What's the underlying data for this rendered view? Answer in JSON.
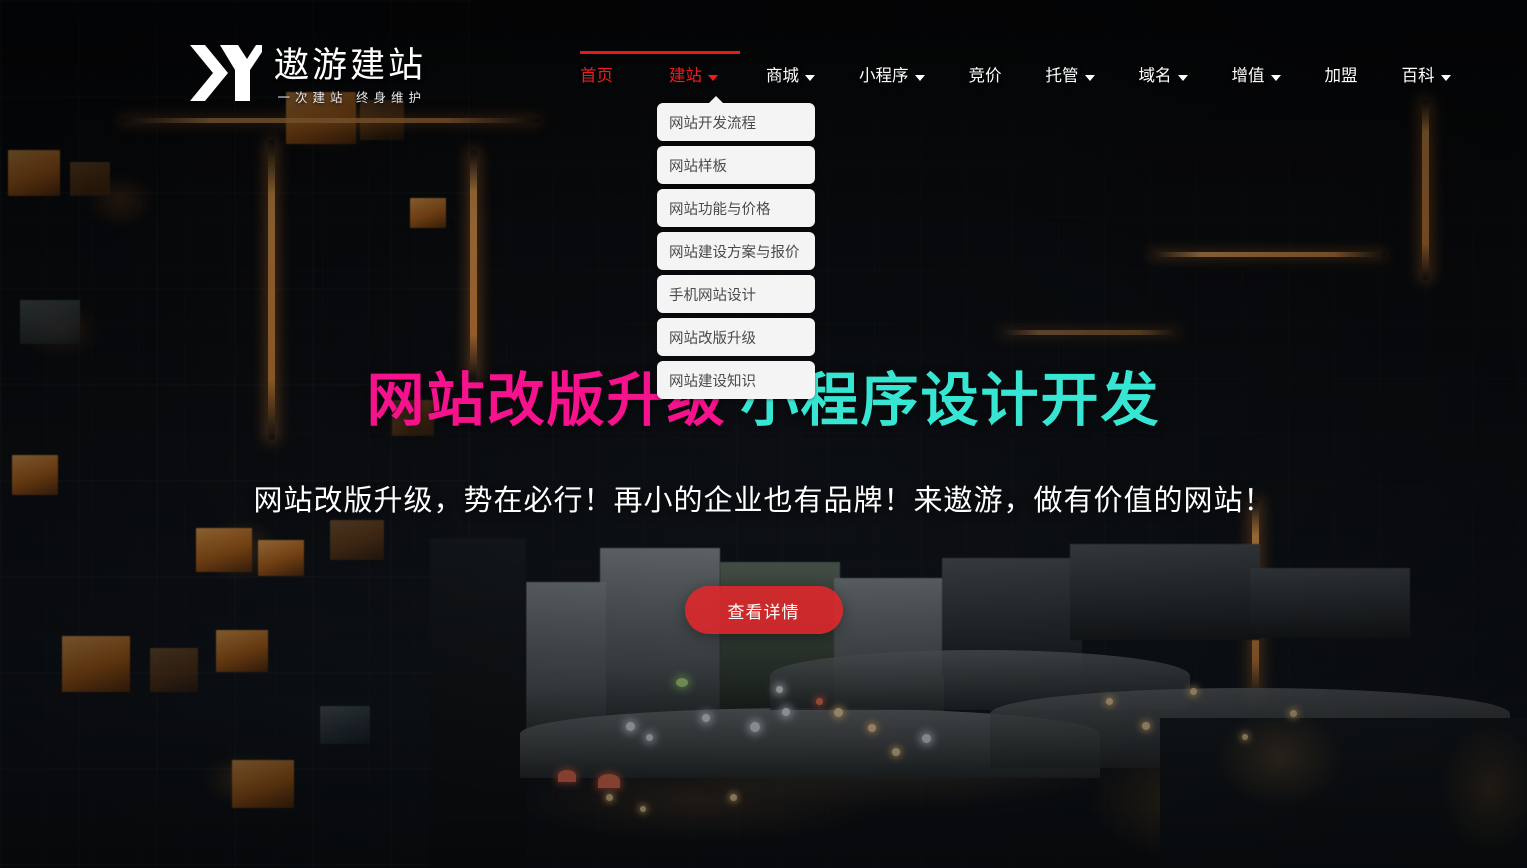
{
  "site": {
    "logo_icon": "chevron-y-logo-icon",
    "title": "遨游建站",
    "tagline": "一次建站  终身维护"
  },
  "nav": {
    "items": [
      {
        "label": "首页",
        "active": true,
        "has_dropdown": false
      },
      {
        "label": "建站",
        "active": true,
        "has_dropdown": true
      },
      {
        "label": "商城",
        "active": false,
        "has_dropdown": true
      },
      {
        "label": "小程序",
        "active": false,
        "has_dropdown": true
      },
      {
        "label": "竞价",
        "active": false,
        "has_dropdown": false
      },
      {
        "label": "托管",
        "active": false,
        "has_dropdown": true
      },
      {
        "label": "域名",
        "active": false,
        "has_dropdown": true
      },
      {
        "label": "增值",
        "active": false,
        "has_dropdown": true
      },
      {
        "label": "加盟",
        "active": false,
        "has_dropdown": false
      },
      {
        "label": "百科",
        "active": false,
        "has_dropdown": true
      }
    ],
    "accent_color": "#e8191c"
  },
  "dropdown": {
    "owner": "建站",
    "items": [
      {
        "label": "网站开发流程"
      },
      {
        "label": "网站样板"
      },
      {
        "label": "网站功能与价格"
      },
      {
        "label": "网站建设方案与报价"
      },
      {
        "label": "手机网站设计"
      },
      {
        "label": "网站改版升级"
      },
      {
        "label": "网站建设知识"
      }
    ]
  },
  "hero": {
    "headline_part_a": "网站改版升级",
    "headline_part_b": "小程序设计开发",
    "headline_color_a": "#f5128c",
    "headline_color_b": "#37e6d2",
    "subline": "网站改版升级，势在必行！再小的企业也有品牌！来遨游，做有价值的网站！",
    "cta_label": "查看详情",
    "cta_color": "#e4262a"
  }
}
